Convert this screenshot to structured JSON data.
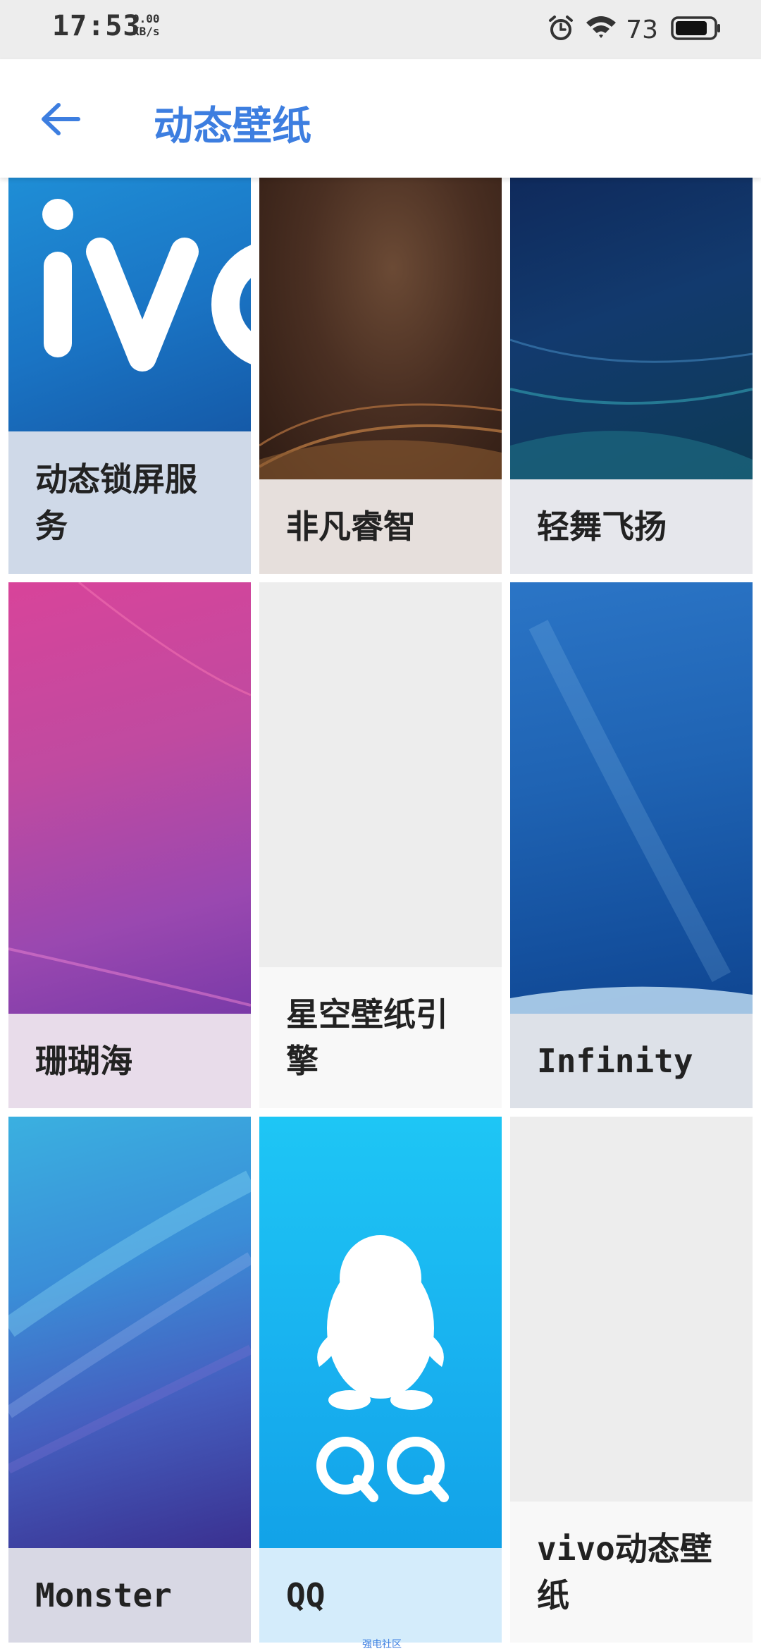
{
  "status_bar": {
    "time": "17:53",
    "net_speed_value": "0.00",
    "net_speed_unit": "KB/s",
    "battery_percent": "73",
    "icons": [
      "alarm-icon",
      "wifi-icon",
      "battery-icon"
    ]
  },
  "header": {
    "back_icon": "arrow-left-icon",
    "title": "动态壁纸",
    "accent_color": "#3d7ee0"
  },
  "wallpapers": [
    {
      "name": "动态锁屏服务",
      "art": "vivo logo on blue"
    },
    {
      "name": "非凡睿智",
      "art": "brown gradient"
    },
    {
      "name": "轻舞飞扬",
      "art": "dark blue waves"
    },
    {
      "name": "珊瑚海",
      "art": "pink purple gradient"
    },
    {
      "name": "星空壁纸引擎",
      "art": "blank"
    },
    {
      "name": "Infinity",
      "art": "blue starfield"
    },
    {
      "name": "Monster",
      "art": "blue violet waves"
    },
    {
      "name": "QQ",
      "art": "QQ penguin logo"
    },
    {
      "name": "vivo动态壁纸",
      "art": "blank"
    }
  ],
  "footer": {
    "watermark": "强电社区"
  }
}
